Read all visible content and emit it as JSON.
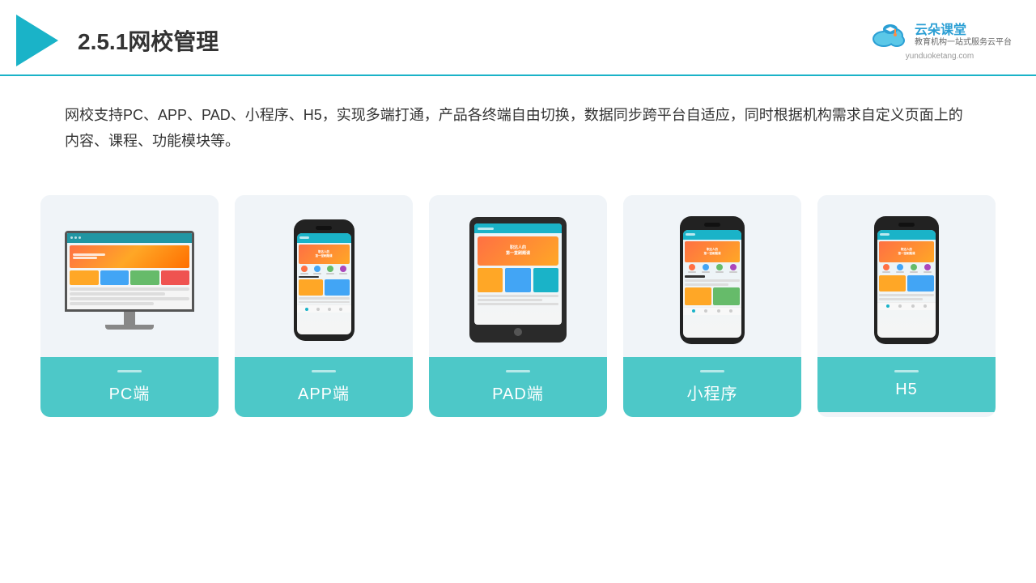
{
  "header": {
    "title": "2.5.1网校管理",
    "brand_name": "云朵课堂",
    "brand_url": "yunduoketang.com",
    "brand_tagline": "教育机构一站\n式服务云平台"
  },
  "description": {
    "text": "网校支持PC、APP、PAD、小程序、H5，实现多端打通，产品各终端自由切换，数据同步跨平台自适应，同时根据机构需求自定义页面上的内容、课程、功能模块等。"
  },
  "cards": [
    {
      "id": "pc",
      "label": "PC端"
    },
    {
      "id": "app",
      "label": "APP端"
    },
    {
      "id": "pad",
      "label": "PAD端"
    },
    {
      "id": "miniprogram",
      "label": "小程序"
    },
    {
      "id": "h5",
      "label": "H5"
    }
  ],
  "colors": {
    "accent": "#1ab3c8",
    "label_bg": "#4dc8c8",
    "card_bg": "#f0f4f8"
  }
}
